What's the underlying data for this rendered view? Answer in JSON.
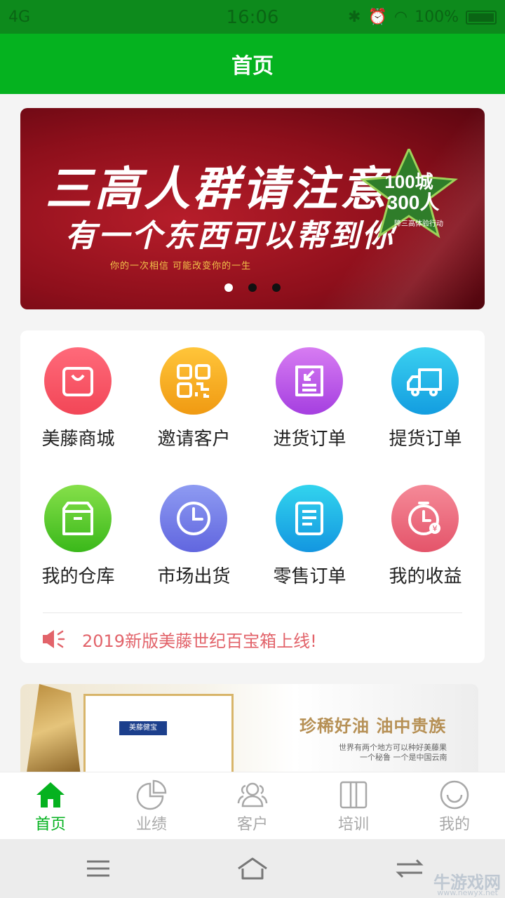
{
  "status": {
    "network": "4G",
    "time": "16:06",
    "battery": "100%"
  },
  "header": {
    "title": "首页"
  },
  "banner": {
    "headline": "三高人群请注意",
    "subline": "有一个东西可以帮到你",
    "tagline": "你的一次相信  可能改变你的一生",
    "badge_line1": "100城",
    "badge_line2": "300人",
    "badge_line3": "降三高体验行动"
  },
  "menu": {
    "items": [
      {
        "label": "美藤商城",
        "icon": "shopping-bag-icon",
        "color1": "#ff6a7a",
        "color2": "#f24657"
      },
      {
        "label": "邀请客户",
        "icon": "qr-code-icon",
        "color1": "#ffc53a",
        "color2": "#f09a12"
      },
      {
        "label": "进货订单",
        "icon": "inbound-order-icon",
        "color1": "#d77cf2",
        "color2": "#a53fe0"
      },
      {
        "label": "提货订单",
        "icon": "truck-icon",
        "color1": "#3ad0f0",
        "color2": "#139de0"
      },
      {
        "label": "我的仓库",
        "icon": "box-icon",
        "color1": "#86e04a",
        "color2": "#3ab81a"
      },
      {
        "label": "市场出货",
        "icon": "clock-icon",
        "color1": "#8e9bf2",
        "color2": "#6166df"
      },
      {
        "label": "零售订单",
        "icon": "document-icon",
        "color1": "#32d4ee",
        "color2": "#1396e0"
      },
      {
        "label": "我的收益",
        "icon": "timer-yen-icon",
        "color1": "#f58a98",
        "color2": "#e4546a"
      }
    ],
    "notice": "2019新版美藤世纪百宝箱上线!"
  },
  "promo": {
    "title": "珍稀好油 油中贵族",
    "line1": "世界有两个地方可以种好美藤果",
    "line2": "一个秘鲁 一个是中国云南",
    "brand": "美藤健宝"
  },
  "tabs": [
    {
      "label": "首页",
      "icon": "home-icon",
      "active": true
    },
    {
      "label": "业绩",
      "icon": "pie-chart-icon",
      "active": false
    },
    {
      "label": "客户",
      "icon": "users-icon",
      "active": false
    },
    {
      "label": "培训",
      "icon": "book-icon",
      "active": false
    },
    {
      "label": "我的",
      "icon": "smile-icon",
      "active": false
    }
  ],
  "watermark": {
    "name": "牛游戏网",
    "url": "www.newyx.net"
  }
}
